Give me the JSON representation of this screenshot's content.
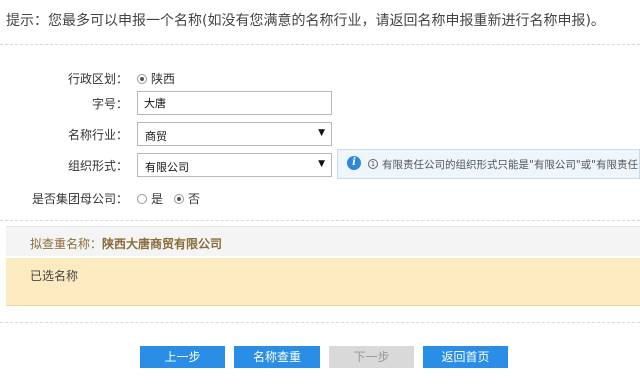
{
  "tip": "提示：您最多可以申报一个名称(如没有您满意的名称行业，请返回名称申报重新进行名称申报)。",
  "form": {
    "region": {
      "label": "行政区划：",
      "option": "陕西"
    },
    "brand": {
      "label": "字号：",
      "value": "大唐"
    },
    "industry": {
      "label": "名称行业：",
      "value": "商贸"
    },
    "org_form": {
      "label": "组织形式：",
      "value": "有限公司",
      "hint_icon": "info-icon",
      "hint": "有限责任公司的组织形式只能是\"有限公司\"或\"有限责任公"
    },
    "group_parent": {
      "label": "是否集团母公司：",
      "yes": "是",
      "no": "否",
      "selected": "no"
    }
  },
  "proposed": {
    "label": "拟查重名称：",
    "value": "陕西大唐商贸有限公司"
  },
  "selected_names": {
    "label": "已选名称"
  },
  "buttons": {
    "prev": "上一步",
    "check": "名称查重",
    "next": "下一步",
    "home": "返回首页"
  },
  "colors": {
    "primary": "#2a8ee6",
    "disabled": "#d9d9d9",
    "hint_bg": "#eef6fc",
    "selected_bg": "#fcebc0",
    "proposed_text": "#8a6d3b"
  }
}
